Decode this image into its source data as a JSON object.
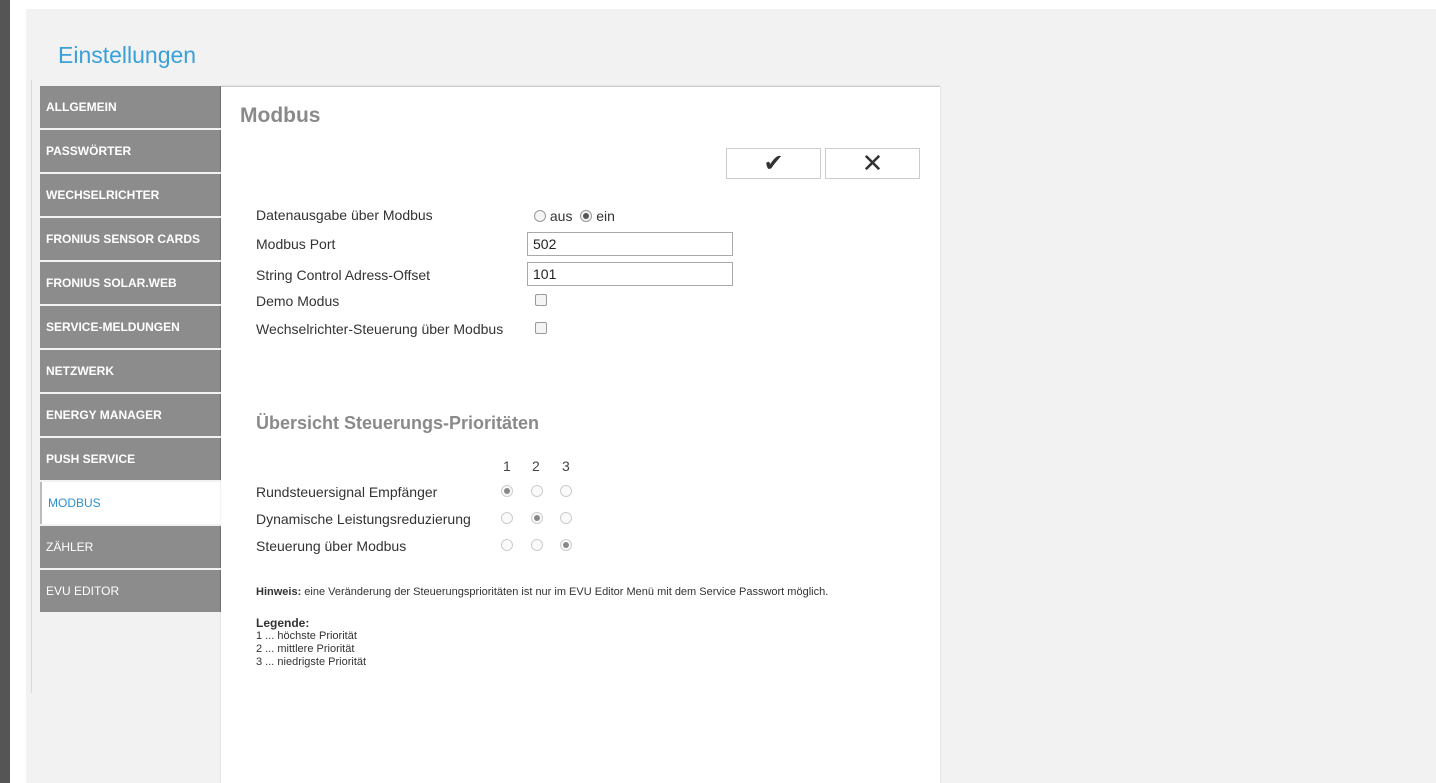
{
  "page": {
    "title": "Einstellungen"
  },
  "menu": [
    {
      "label": "ALLGEMEIN"
    },
    {
      "label": "PASSWÖRTER"
    },
    {
      "label": "WECHSELRICHTER"
    },
    {
      "label": "FRONIUS SENSOR CARDS"
    },
    {
      "label": "FRONIUS SOLAR.WEB"
    },
    {
      "label": "SERVICE-MELDUNGEN"
    },
    {
      "label": "NETZWERK"
    },
    {
      "label": "ENERGY MANAGER"
    },
    {
      "label": "PUSH SERVICE"
    },
    {
      "label": "MODBUS",
      "active": true
    },
    {
      "label": "ZÄHLER"
    },
    {
      "label": "EVU EDITOR"
    }
  ],
  "panel": {
    "title": "Modbus",
    "ok_icon": "✔",
    "cancel_icon": "✕",
    "fields": {
      "datenausgabe": {
        "label": "Datenausgabe über Modbus",
        "option_aus": "aus",
        "option_ein": "ein",
        "selected": "ein"
      },
      "port": {
        "label": "Modbus Port",
        "value": "502"
      },
      "offset": {
        "label": "String Control Adress-Offset",
        "value": "101"
      },
      "demo": {
        "label": "Demo Modus",
        "checked": false
      },
      "wr_steuerung": {
        "label": "Wechselrichter-Steuerung über Modbus",
        "checked": false
      }
    },
    "priorities": {
      "title": "Übersicht Steuerungs-Prioritäten",
      "columns": [
        "1",
        "2",
        "3"
      ],
      "rows": [
        {
          "label": "Rundsteuersignal Empfänger",
          "selected": "1"
        },
        {
          "label": "Dynamische Leistungsreduzierung",
          "selected": "2"
        },
        {
          "label": "Steuerung über Modbus",
          "selected": "3"
        }
      ]
    },
    "note": {
      "bold": "Hinweis:",
      "text": " eine Veränderung der Steuerungsprioritäten ist nur im EVU Editor Menü mit dem Service Passwort möglich."
    },
    "legend": {
      "title": "Legende:",
      "items": [
        "1 ... höchste Priorität",
        "2 ... mittlere Priorität",
        "3 ... niedrigste Priorität"
      ]
    }
  }
}
